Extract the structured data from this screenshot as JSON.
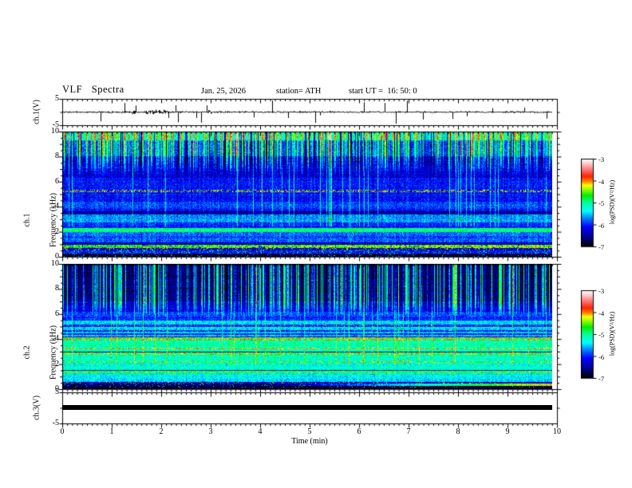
{
  "title": {
    "main": "VLF Spectra",
    "date": "Jan. 25, 2026",
    "station": "station= ATH",
    "start_ut": "start UT =  16: 50: 0"
  },
  "panels": {
    "ch1_wave": {
      "ylabel": "ch.1(V)",
      "ymax": "5",
      "ymin": "-5"
    },
    "spec1": {
      "ylabel_line1": "ch.1",
      "ylabel_line2": "Frequency (kHz)",
      "yticks": [
        "10",
        "8",
        "6",
        "4",
        "2",
        "0"
      ]
    },
    "spec2": {
      "ylabel_line1": "ch.2",
      "ylabel_line2": "Frequency (kHz)",
      "yticks": [
        "10",
        "8",
        "6",
        "4",
        "2",
        "0"
      ]
    },
    "ch3_wave": {
      "ylabel": "ch.3(V)",
      "ymax": "5",
      "ymin": "-5"
    }
  },
  "xaxis": {
    "label": "Time (min)",
    "ticks": [
      "0",
      "1",
      "2",
      "3",
      "4",
      "5",
      "6",
      "7",
      "8",
      "9",
      "10"
    ]
  },
  "colorbar": {
    "label": "log(PSD)(V²/Hz)",
    "ticks": [
      "-3",
      "-4",
      "-5",
      "-6",
      "-7"
    ],
    "stops": [
      {
        "t": 0.0,
        "c": "#000000"
      },
      {
        "t": 0.1,
        "c": "#00008b"
      },
      {
        "t": 0.22,
        "c": "#0000ff"
      },
      {
        "t": 0.32,
        "c": "#0080ff"
      },
      {
        "t": 0.4,
        "c": "#00ffff"
      },
      {
        "t": 0.5,
        "c": "#00ff99"
      },
      {
        "t": 0.58,
        "c": "#00ee00"
      },
      {
        "t": 0.66,
        "c": "#aaff00"
      },
      {
        "t": 0.7,
        "c": "#ffff00"
      },
      {
        "t": 0.74,
        "c": "#ff8800"
      },
      {
        "t": 0.8,
        "c": "#ff2200"
      },
      {
        "t": 0.88,
        "c": "#ff7777"
      },
      {
        "t": 0.95,
        "c": "#ffcccc"
      },
      {
        "t": 1.0,
        "c": "#ffffff"
      }
    ]
  },
  "frame_color": "#000000",
  "background": "#ffffff",
  "chart_data": [
    {
      "panel": "ch1_waveform",
      "type": "line",
      "ylabel": "ch.1(V)",
      "ylim": [
        -5,
        5
      ],
      "xlim_min": [
        0,
        10
      ],
      "description": "broadband noise centred on 0 V with impulsive spikes up to about +/-4.5 V, trace ends at 9.9 min",
      "render": {
        "seed": 11,
        "noise_amp": 0.42,
        "spike_prob": 0.05,
        "spike_min": 1.2,
        "spike_span": 3.3,
        "down_bias": 0.6,
        "burst_prob": 0.012,
        "end_min": 9.9
      }
    },
    {
      "panel": "ch1_spectrogram",
      "type": "heatmap",
      "flim_khz": [
        0,
        10
      ],
      "xlim_min": [
        0,
        10
      ],
      "clim_log_psd": [
        -7,
        -3
      ],
      "description": "blue background; dense green/yellow vertical striping above ~6.5 kHz; green line at 2 kHz; olive-orange band near 0.8 kHz; black below 0.3 kHz",
      "bands": [
        {
          "f": [
            9.3,
            10.01
          ],
          "level": -5.15
        },
        {
          "f": [
            8.0,
            9.3
          ],
          "level": -5.8
        },
        {
          "f": [
            6.3,
            8.0
          ],
          "level": -6.35
        },
        {
          "f": [
            4.3,
            6.3
          ],
          "level": -6.1
        },
        {
          "f": [
            5.18,
            5.34
          ],
          "level": -6.2,
          "dither_level": -4.3,
          "dither_p": 0.4
        },
        {
          "f": [
            3.8,
            4.3
          ],
          "level": -5.9
        },
        {
          "f": [
            3.35,
            3.65
          ],
          "level": -6.5
        },
        {
          "f": [
            2.75,
            3.35
          ],
          "level": -5.7
        },
        {
          "f": [
            2.3,
            2.75
          ],
          "level": -6.05
        },
        {
          "f": [
            1.95,
            2.3
          ],
          "level": -4.95
        },
        {
          "f": [
            1.15,
            1.95
          ],
          "level": -5.85
        },
        {
          "f": [
            0.95,
            1.15
          ],
          "level": -6.35
        },
        {
          "f": [
            0.72,
            0.95
          ],
          "level": -4.65,
          "x_ramp": 0.25,
          "dither_level": -6.3,
          "dither_p": 0.15
        },
        {
          "f": [
            0.5,
            0.72
          ],
          "level": -6.45,
          "dither_level": -4.4,
          "dither_p": 0.15
        },
        {
          "f": [
            0.28,
            0.5
          ],
          "level": -6.1,
          "dither_level": -5.2,
          "dither_p": 0.1
        },
        {
          "f": [
            0,
            0.28
          ],
          "level": -6.9,
          "dither_level": -5.4,
          "dither_p": 0.05
        }
      ],
      "texture": {
        "seed": 7,
        "pixel_noise": 0.3,
        "row_noise": 0.1,
        "col_jitter": 0.13,
        "top_streaks": {
          "prob": 0.45,
          "boost_min": 0.5,
          "boost_max": 1.6,
          "full_above": 8.2,
          "fade_to": 6.3
        },
        "dark_streaks": {
          "prob": 0.25,
          "drop": 1.3,
          "full_above": 8.6,
          "fade_to": 6.8
        },
        "tall_lines": {
          "prob": 0.055,
          "boost": 0.75,
          "f_min": 2.4
        }
      }
    },
    {
      "panel": "ch2_spectrogram",
      "type": "heatmap",
      "flim_khz": [
        0,
        10
      ],
      "xlim_min": [
        0,
        10
      ],
      "clim_log_psd": [
        -7,
        -3
      ],
      "description": "very dark above 7 kHz with bright cyan/green vertical streaks; cyan-green below 5.5 kHz; orange harmonic lines near 4.0, 3.25, 2.8, 2.2, 1.4 kHz; red streak near 0.35 kHz growing toward the right",
      "bands": [
        {
          "f": [
            9.82,
            10.01
          ],
          "level": -6.8
        },
        {
          "f": [
            7.0,
            9.82
          ],
          "level": -6.65
        },
        {
          "f": [
            6.2,
            7.0
          ],
          "level": -6.3
        },
        {
          "f": [
            5.5,
            6.2
          ],
          "level": -5.95
        },
        {
          "f": [
            4.2,
            5.5
          ],
          "level": -5.45
        },
        {
          "f": [
            5.0,
            5.15
          ],
          "level": -6.1,
          "dither_level": -4.5,
          "dither_p": 0.07
        },
        {
          "f": [
            4.6,
            4.72
          ],
          "level": -6.05,
          "dither_level": -4.5,
          "dither_p": 0.07
        },
        {
          "f": [
            4.35,
            4.45
          ],
          "level": -6.0
        },
        {
          "f": [
            3.9,
            4.15
          ],
          "level": -4.85,
          "dither_level": -4.1,
          "dither_p": 0.45
        },
        {
          "f": [
            3.0,
            3.9
          ],
          "level": -5.1
        },
        {
          "f": [
            3.18,
            3.32
          ],
          "level": -4.9,
          "dither_level": -4.15,
          "dither_p": 0.5
        },
        {
          "f": [
            2.72,
            2.9
          ],
          "level": -5.0,
          "dither_level": -4.2,
          "dither_p": 0.45
        },
        {
          "f": [
            2.25,
            2.72
          ],
          "level": -5.15
        },
        {
          "f": [
            2.1,
            2.25
          ],
          "level": -4.95,
          "dither_level": -4.3,
          "dither_p": 0.35
        },
        {
          "f": [
            1.55,
            2.1
          ],
          "level": -5.25
        },
        {
          "f": [
            1.3,
            1.47
          ],
          "level": -4.9,
          "dither_level": -4.4,
          "dither_p": 0.3
        },
        {
          "f": [
            0.85,
            1.3
          ],
          "level": -5.3
        },
        {
          "f": [
            0.6,
            0.85
          ],
          "level": -5.5
        },
        {
          "f": [
            0.42,
            0.6
          ],
          "level": -6.35,
          "dither_level": -4.4,
          "dither_p": 0.1
        },
        {
          "f": [
            0.25,
            0.42
          ],
          "level": -6.7,
          "ramp": {
            "start_min": 4.2,
            "end_level": -4.05
          },
          "dither_level": -5.2,
          "dither_p": 0.05
        },
        {
          "f": [
            0.1,
            0.25
          ],
          "level": -6.85,
          "dither_level": -4.6,
          "dither_p": 0.05
        },
        {
          "f": [
            0,
            0.1
          ],
          "level": -6.95
        }
      ],
      "texture": {
        "seed": 23,
        "pixel_noise": 0.3,
        "row_noise": 0.1,
        "col_jitter": 0.12,
        "top_streaks": {
          "prob": 0.33,
          "boost_min": 0.6,
          "boost_max": 2.1,
          "full_above": 7.0,
          "fade_to": 5.8
        },
        "dark_streaks": {
          "prob": 0.12,
          "drop": 0.5,
          "full_above": 9.0,
          "fade_to": 7.5
        },
        "tall_lines": {
          "prob": 0.05,
          "boost": 0.7,
          "f_min": 2.0
        }
      }
    },
    {
      "panel": "ch3_waveform",
      "type": "line",
      "ylabel": "ch.3(V)",
      "ylim": [
        -5,
        5
      ],
      "xlim_min": [
        0,
        10
      ],
      "description": "flat saturated trace at 0 V from 0 to 9.9 min",
      "render": {
        "line_value": 0,
        "thickness_px": 6,
        "end_min": 9.9
      }
    }
  ]
}
